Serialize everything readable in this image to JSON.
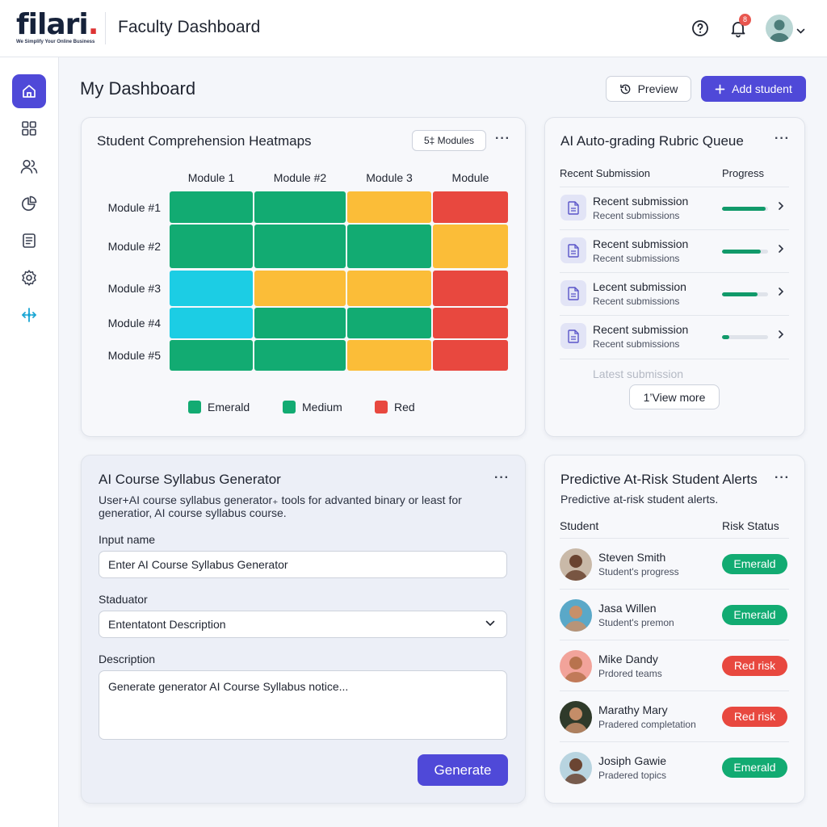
{
  "brand": {
    "logo_text": "filari",
    "logo_dot": ".",
    "tagline": "We Simplify Your Online Business"
  },
  "header": {
    "title": "Faculty Dashboard",
    "notification_count": "8"
  },
  "sidebar": {
    "items": [
      {
        "id": "home",
        "icon": "home-icon",
        "active": true
      },
      {
        "id": "grid",
        "icon": "grid-icon",
        "active": false
      },
      {
        "id": "users",
        "icon": "users-icon",
        "active": false
      },
      {
        "id": "analytics",
        "icon": "pie-chart-icon",
        "active": false
      },
      {
        "id": "reports",
        "icon": "document-list-icon",
        "active": false
      },
      {
        "id": "settings",
        "icon": "gear-icon",
        "active": false
      },
      {
        "id": "connect",
        "icon": "network-icon",
        "active": false
      }
    ]
  },
  "page": {
    "title": "My Dashboard",
    "preview_label": "Preview",
    "add_student_label": "Add student"
  },
  "heatmap": {
    "title": "Student Comprehension Heatmaps",
    "chip_label": "5‡ Modules",
    "columns": [
      "Module 1",
      "Module #2",
      "Module 3",
      "Module"
    ],
    "rows": [
      {
        "label": "Module #1",
        "cells": [
          "green",
          "green",
          "yellow",
          "red"
        ]
      },
      {
        "label": "Module #2",
        "cells": [
          "green",
          "green",
          "green",
          "yellow"
        ]
      },
      {
        "label": "Module #3",
        "cells": [
          "cyan",
          "yellow",
          "yellow",
          "red"
        ]
      },
      {
        "label": "Module #4",
        "cells": [
          "cyan",
          "green",
          "green",
          "red"
        ]
      },
      {
        "label": "Module #5",
        "cells": [
          "green",
          "green",
          "yellow",
          "red"
        ]
      }
    ],
    "legend": [
      {
        "label": "Emerald",
        "color": "#12ab72"
      },
      {
        "label": "Medium",
        "color": "#12ab72"
      },
      {
        "label": "Red",
        "color": "#e8483f"
      }
    ],
    "colors": {
      "green": "#12ab72",
      "yellow": "#fbbd38",
      "red": "#e8483f",
      "cyan": "#1ccde4"
    }
  },
  "queue": {
    "title": "AI Auto-grading Rubric Queue",
    "col_submission": "Recent Submission",
    "col_progress": "Progress",
    "items": [
      {
        "title": "Recent submission",
        "subtitle": "Recent submissions",
        "progress": 0.95
      },
      {
        "title": "Recent submission",
        "subtitle": "Recent submissions",
        "progress": 0.85
      },
      {
        "title": "Lecent submission",
        "subtitle": "Recent submissions",
        "progress": 0.78
      },
      {
        "title": "Recent submission",
        "subtitle": "Recent submissions",
        "progress": 0.15
      }
    ],
    "faded_item": "Latest submission",
    "view_more_label": "1’View more"
  },
  "syllabus": {
    "title": "AI Course Syllabus Generator",
    "description": "User+AI course syllabus generator₊ tools for advanted binary or least for generatior, AI course syllabus course.",
    "input_label": "Input name",
    "input_value": "Enter AI Course Syllabus Generator",
    "select_label": "Staduator",
    "select_value": "Ententatont Description",
    "description_label": "Description",
    "description_value": "Generate generator AI Course Syllabus notice...",
    "generate_label": "Generate"
  },
  "alerts": {
    "title": "Predictive At-Risk Student Alerts",
    "subtitle": "Predictive at-risk student alerts.",
    "col_student": "Student",
    "col_status": "Risk Status",
    "students": [
      {
        "name": "Steven Smith",
        "detail": "Student's progress",
        "status": "Emerald",
        "status_color": "#12ab72",
        "avatar_bg": "#c9b9a8",
        "skin": "#6a4330"
      },
      {
        "name": "Jasa Willen",
        "detail": "Student's premon",
        "status": "Emerald",
        "status_color": "#12ab72",
        "avatar_bg": "#5aa8c8",
        "skin": "#c8906a"
      },
      {
        "name": "Mike Dandy",
        "detail": "Prdored teams",
        "status": "Red risk",
        "status_color": "#e8483f",
        "avatar_bg": "#f2a39a",
        "skin": "#b8734e"
      },
      {
        "name": "Marathy Mary",
        "detail": "Pradered completation",
        "status": "Red risk",
        "status_color": "#e8483f",
        "avatar_bg": "#2f3a2a",
        "skin": "#c48d68"
      },
      {
        "name": "Josiph Gawie",
        "detail": "Pradered topics",
        "status": "Emerald",
        "status_color": "#12ab72",
        "avatar_bg": "#b8d4e0",
        "skin": "#6b4532"
      }
    ]
  }
}
